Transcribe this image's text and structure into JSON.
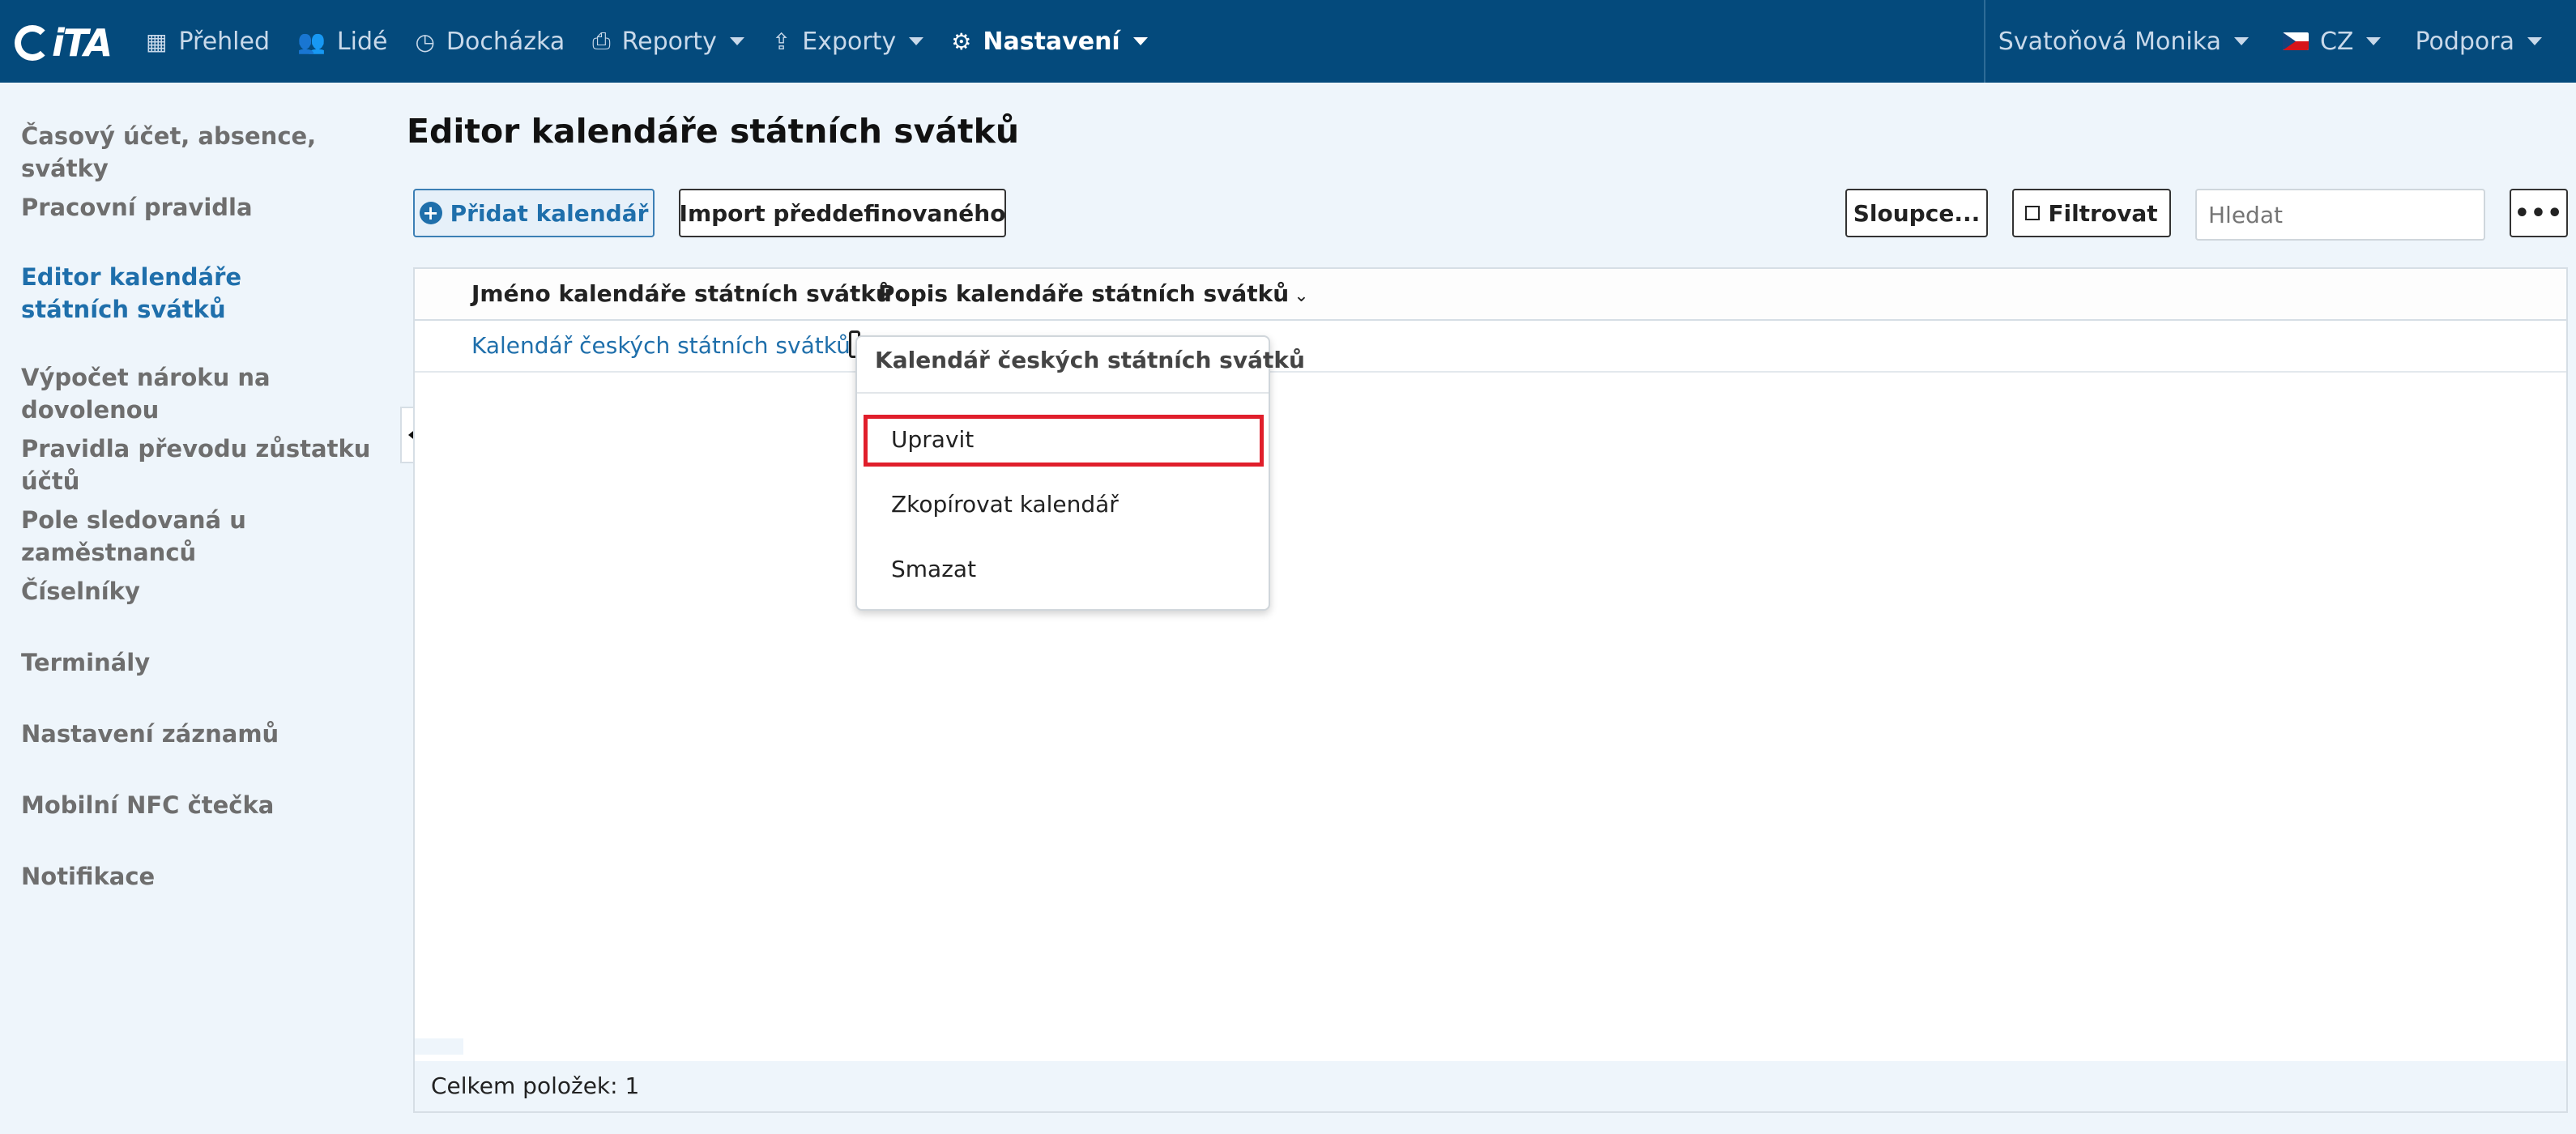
{
  "brand": {
    "logo_text": "iTA"
  },
  "nav": {
    "items": [
      {
        "label": "Přehled",
        "icon": "grid-icon"
      },
      {
        "label": "Lidé",
        "icon": "users-icon"
      },
      {
        "label": "Docházka",
        "icon": "clock-icon"
      },
      {
        "label": "Reporty",
        "icon": "print-icon"
      },
      {
        "label": "Exporty",
        "icon": "export-icon"
      },
      {
        "label": "Nastavení",
        "icon": "gear-icon"
      }
    ],
    "active": "Nastavení"
  },
  "topright": {
    "user": "Svatoňová Monika",
    "language": "CZ",
    "support": "Podpora"
  },
  "sidebar": {
    "items": [
      {
        "label": "Časový účet, absence, svátky"
      },
      {
        "label": "Pracovní pravidla"
      },
      {
        "label": "Editor kalendáře státních svátků",
        "active": true
      },
      {
        "label": "Výpočet nároku na dovolenou"
      },
      {
        "label": "Pravidla převodu zůstatku účtů"
      },
      {
        "label": "Pole sledovaná u zaměstnanců"
      },
      {
        "label": "Číselníky"
      },
      {
        "label": "Terminály"
      },
      {
        "label": "Nastavení záznamů"
      },
      {
        "label": "Mobilní NFC čtečka"
      },
      {
        "label": "Notifikace"
      }
    ]
  },
  "main": {
    "title": "Editor kalendáře státních svátků",
    "toolbar": {
      "add_label": "Přidat kalendář",
      "import_label": "Import předdefinovaného",
      "columns_label": "Sloupce...",
      "filter_label": "Filtrovat",
      "search_placeholder": "Hledat",
      "more_label": "•••"
    },
    "table": {
      "columns": [
        "Jméno kalendáře státních svátků",
        "Popis kalendáře státních svátků"
      ],
      "rows": [
        {
          "name": "Kalendář českých státních svátků",
          "description": ""
        }
      ],
      "footer": "Celkem položek: 1"
    },
    "context_menu": {
      "title": "Kalendář českých státních svátků",
      "items": [
        "Upravit",
        "Zkopírovat kalendář",
        "Smazat"
      ],
      "highlighted": "Upravit"
    }
  },
  "colors": {
    "topbar": "#044a7c",
    "accent": "#1f6fab",
    "highlight": "#e01e2b",
    "background": "#eef5fb"
  }
}
